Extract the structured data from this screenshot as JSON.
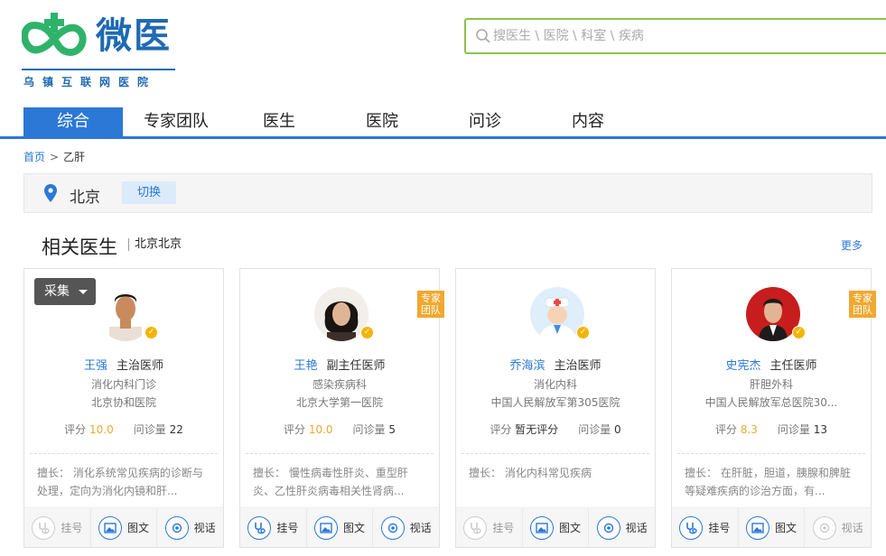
{
  "brand": {
    "name": "微医",
    "subtitle": "乌镇互联网医院",
    "color": "#1f6ab3",
    "accent": "#2fb36b"
  },
  "search": {
    "placeholder": "搜医生 \\ 医院 \\ 科室 \\ 疾病"
  },
  "nav": {
    "tabs": [
      {
        "label": "综合",
        "active": true
      },
      {
        "label": "专家团队"
      },
      {
        "label": "医生"
      },
      {
        "label": "医院"
      },
      {
        "label": "问诊"
      },
      {
        "label": "内容"
      }
    ]
  },
  "breadcrumb": {
    "home": "首页",
    "sep": ">",
    "current": "乙肝"
  },
  "location": {
    "city": "北京",
    "switch_label": "切换"
  },
  "section": {
    "title": "相关医生",
    "subtitle": "北京北京",
    "more_label": "更多"
  },
  "collect_label": "采集",
  "labels": {
    "score": "评分",
    "consults": "问诊量",
    "skill_prefix": "擅长：",
    "team_badge": "专家团队"
  },
  "actions": {
    "register": "挂号",
    "text": "图文",
    "video": "视话"
  },
  "doctors": [
    {
      "name": "王强",
      "title": "主治医师",
      "dept": "消化内科门诊",
      "hospital": "北京协和医院",
      "score": "10.0",
      "consults": "22",
      "skill": "消化系统常见疾病的诊断与处理，定向为消化内镜和肝...",
      "team": false,
      "register_enabled": false
    },
    {
      "name": "王艳",
      "title": "副主任医师",
      "dept": "感染疾病科",
      "hospital": "北京大学第一医院",
      "score": "10.0",
      "consults": "5",
      "skill": "慢性病毒性肝炎、重型肝炎、乙性肝炎病毒相关性肾病...",
      "team": true,
      "register_enabled": true
    },
    {
      "name": "乔海滨",
      "title": "主治医师",
      "dept": "消化内科",
      "hospital": "中国人民解放军第305医院",
      "score": "暂无评分",
      "consults": "0",
      "skill": "消化内科常见疾病",
      "team": false,
      "register_enabled": false
    },
    {
      "name": "史宪杰",
      "title": "主任医师",
      "dept": "肝胆外科",
      "hospital": "中国人民解放军总医院30...",
      "score": "8.3",
      "consults": "13",
      "skill": "在肝脏，胆道，胰腺和脾脏等疑难疾病的诊治方面，有...",
      "team": true,
      "register_enabled": true,
      "video_enabled": false
    }
  ]
}
